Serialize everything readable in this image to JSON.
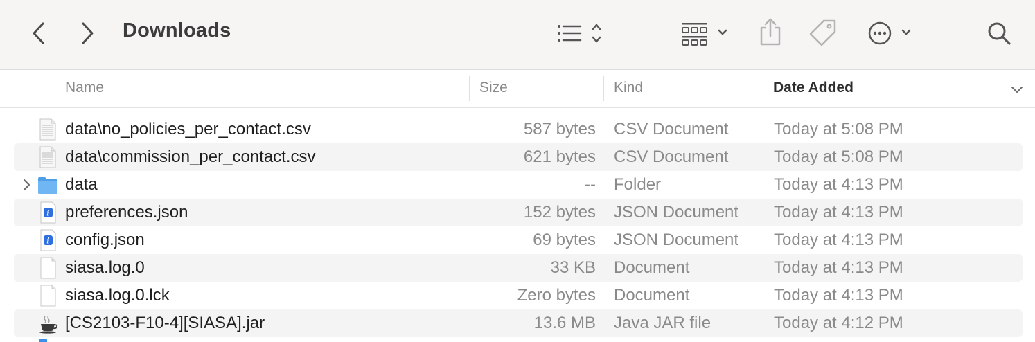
{
  "window": {
    "title": "Downloads"
  },
  "toolbar": {
    "icons": [
      "back-icon",
      "forward-icon",
      "list-view-icon",
      "group-icon",
      "share-icon",
      "tag-icon",
      "more-icon",
      "search-icon"
    ]
  },
  "columns": {
    "name": "Name",
    "size": "Size",
    "kind": "Kind",
    "date_added": "Date Added",
    "sorted_by": "Date Added"
  },
  "files": [
    {
      "name": "data\\no_policies_per_contact.csv",
      "size": "587 bytes",
      "kind": "CSV Document",
      "date_added": "Today at 5:08 PM",
      "icon": "csv-document-icon"
    },
    {
      "name": "data\\commission_per_contact.csv",
      "size": "621 bytes",
      "kind": "CSV Document",
      "date_added": "Today at 5:08 PM",
      "icon": "csv-document-icon"
    },
    {
      "name": "data",
      "size": "--",
      "kind": "Folder",
      "date_added": "Today at 4:13 PM",
      "icon": "folder-icon"
    },
    {
      "name": "preferences.json",
      "size": "152 bytes",
      "kind": "JSON Document",
      "date_added": "Today at 4:13 PM",
      "icon": "json-document-icon"
    },
    {
      "name": "config.json",
      "size": "69 bytes",
      "kind": "JSON Document",
      "date_added": "Today at 4:13 PM",
      "icon": "json-document-icon"
    },
    {
      "name": "siasa.log.0",
      "size": "33 KB",
      "kind": "Document",
      "date_added": "Today at 4:13 PM",
      "icon": "document-icon"
    },
    {
      "name": "siasa.log.0.lck",
      "size": "Zero bytes",
      "kind": "Document",
      "date_added": "Today at 4:13 PM",
      "icon": "document-icon"
    },
    {
      "name": "[CS2103-F10-4][SIASA].jar",
      "size": "13.6 MB",
      "kind": "Java JAR file",
      "date_added": "Today at 4:12 PM",
      "icon": "java-jar-icon"
    }
  ],
  "colors": {
    "toolbar_bg": "#f6f5f4",
    "alt_row_bg": "#f4f4f5",
    "folder_blue": "#5aa9ec",
    "json_blue": "#2f6fe0"
  }
}
